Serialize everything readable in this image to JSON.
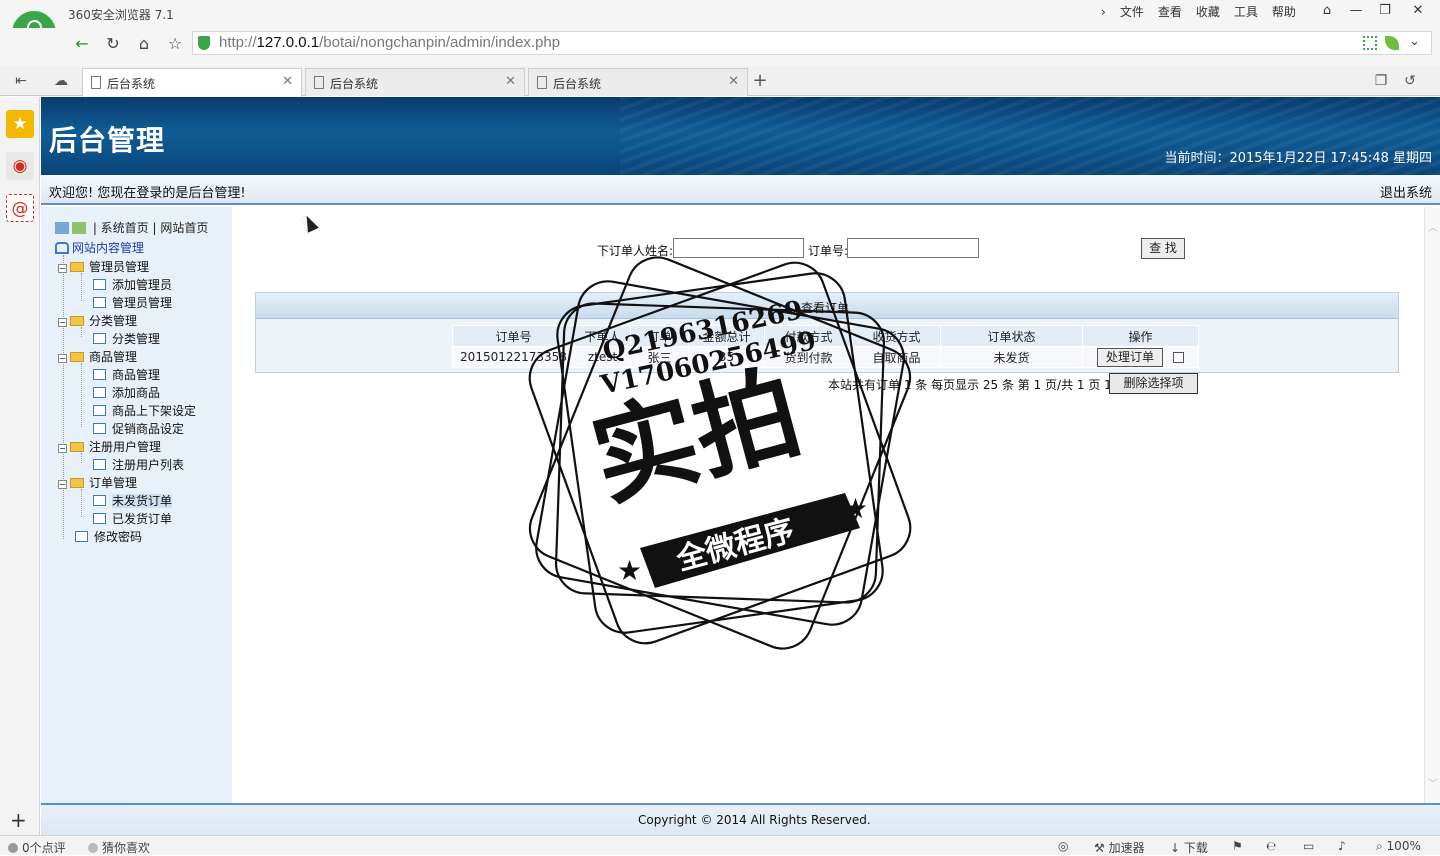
{
  "browser": {
    "title": "360安全浏览器 7.1",
    "menu": [
      "文件",
      "查看",
      "收藏",
      "工具",
      "帮助"
    ],
    "url_prefix": "http://",
    "url_host": "127.0.0.1",
    "url_path": "/botai/nongchanpin/admin/index.php",
    "tabs": [
      {
        "label": "后台系统"
      },
      {
        "label": "后台系统"
      },
      {
        "label": "后台系统"
      }
    ],
    "status": {
      "points": "0个点评",
      "guess": "猜你喜欢",
      "accelerator": "加速器",
      "download": "下载",
      "zoom": "100%"
    }
  },
  "app": {
    "title": "后台管理",
    "time": "当前时间：2015年1月22日 17:45:48 星期四",
    "welcome": "欢迎您! 您现在登录的是后台管理!",
    "logout": "退出系统",
    "toplinks": "| 系统首页 | 网站首页",
    "tree_root": "网站内容管理",
    "tree": {
      "admin": "管理员管理",
      "add_admin": "添加管理员",
      "manage_admin": "管理员管理",
      "category": "分类管理",
      "manage_category": "分类管理",
      "goods": "商品管理",
      "manage_goods": "商品管理",
      "add_goods": "添加商品",
      "goods_shelf": "商品上下架设定",
      "promo": "促销商品设定",
      "users": "注册用户管理",
      "user_list": "注册用户列表",
      "orders": "订单管理",
      "unshipped": "未发货订单",
      "shipped": "已发货订单",
      "password": "修改密码"
    },
    "search": {
      "name_label": "下订单人姓名:",
      "name_value": "",
      "order_label": "订单号:",
      "order_value": "",
      "button": "查 找"
    },
    "orders_panel": {
      "caption": "查看订单",
      "headers": [
        "订单号",
        "下单人",
        "订单",
        "金额总计",
        "付款方式",
        "收货方式",
        "订单状态",
        "操作"
      ],
      "rows": [
        {
          "order_no": "20150122173358",
          "buyer": "ztest",
          "recipient": "张三",
          "total": "35",
          "payment": "货到付款",
          "delivery": "自取商品",
          "status": "未发货",
          "action": "处理订单"
        }
      ],
      "pager": "本站共有订单 1 条 每页显示 25 条 第 1 页/共 1 页 1",
      "delete_button": "删除选择项"
    },
    "footer": "Copyright © 2014 All Rights Reserved."
  },
  "watermark": {
    "line1": "Q2196316269",
    "line2": "V17060256499",
    "big": "实拍",
    "ribbon": "全微程序"
  }
}
